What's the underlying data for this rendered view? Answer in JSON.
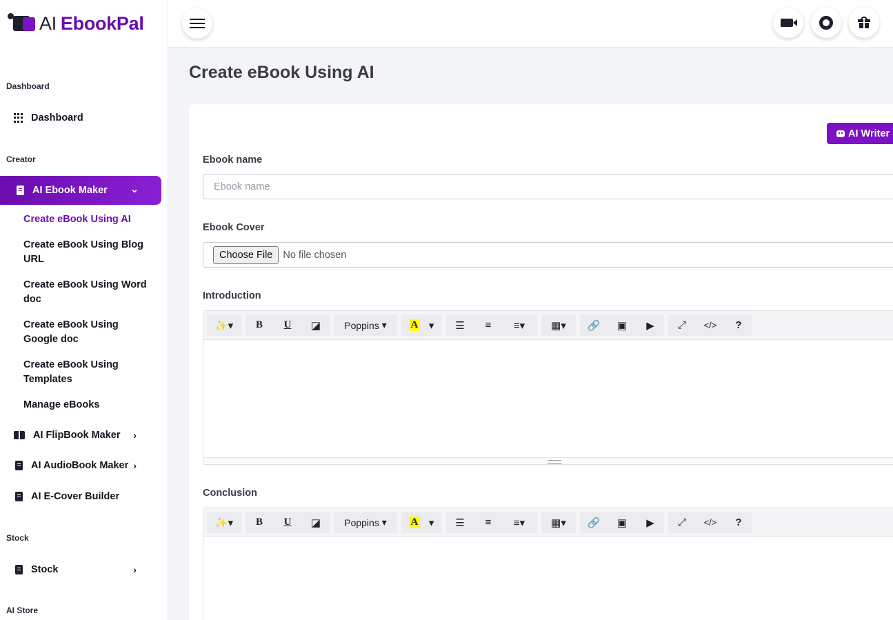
{
  "app": {
    "logo_prefix": "AI",
    "logo_brand": "EbookPal"
  },
  "sidebar": {
    "sections": {
      "dashboard": "Dashboard",
      "creator": "Creator",
      "stock": "Stock",
      "ai_store": "AI Store"
    },
    "dashboard_item": "Dashboard",
    "ebook_maker": "AI Ebook Maker",
    "sub_items": [
      "Create eBook Using AI",
      "Create eBook Using Blog URL",
      "Create eBook Using Word doc",
      "Create eBook Using Google doc",
      "Create eBook Using Templates",
      "Manage eBooks"
    ],
    "flipbook": "AI FlipBook Maker",
    "audiobook": "AI AudioBook Maker",
    "ecover": "AI E-Cover Builder",
    "stock_item": "Stock"
  },
  "page": {
    "title": "Create eBook Using AI"
  },
  "form": {
    "ai_writer_label": "AI Writer",
    "ebook_name_label": "Ebook name",
    "ebook_name_placeholder": "Ebook name",
    "ebook_name_value": "",
    "cover_label": "Ebook Cover",
    "choose_file_label": "Choose File",
    "file_status": "No file chosen",
    "introduction_label": "Introduction",
    "conclusion_label": "Conclusion"
  },
  "editor": {
    "font_name": "Poppins",
    "icons": {
      "magic": "magic-wand-icon",
      "bold": "B",
      "underline": "U",
      "eraser": "eraser-icon",
      "color": "A",
      "ul": "unordered-list-icon",
      "ol": "ordered-list-icon",
      "align": "align-icon",
      "table": "table-icon",
      "link": "link-icon",
      "image": "image-icon",
      "video": "video-icon",
      "fullscreen": "fullscreen-icon",
      "code": "</>",
      "help": "?"
    }
  },
  "colors": {
    "accent": "#6a0dad",
    "button": "#7b12c4",
    "highlight": "#ffff00"
  }
}
